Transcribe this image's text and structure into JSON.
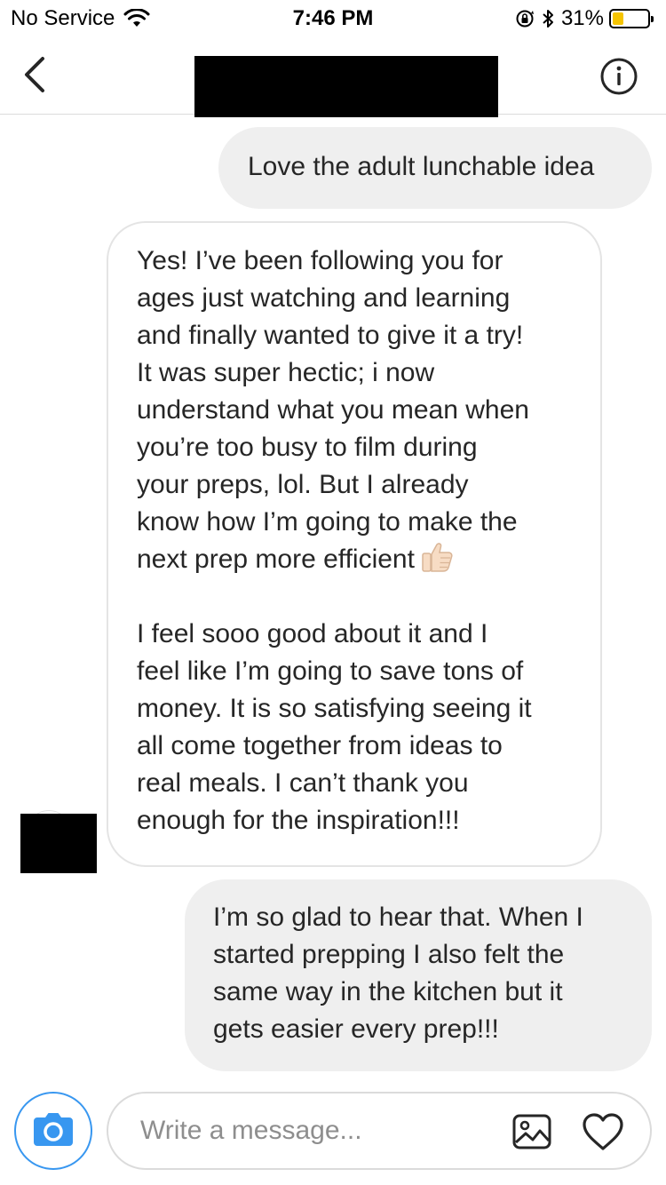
{
  "status_bar": {
    "carrier": "No Service",
    "time": "7:46 PM",
    "battery_percent": "31%",
    "battery_level": 0.31,
    "icons": [
      "wifi-icon",
      "orientation-lock-icon",
      "bluetooth-icon",
      "battery-icon"
    ]
  },
  "nav": {
    "back_icon": "chevron-left-icon",
    "info_icon": "info-icon"
  },
  "messages": [
    {
      "direction": "outgoing",
      "paragraphs": [
        "Love the adult lunchable idea"
      ]
    },
    {
      "direction": "incoming",
      "paragraphs": [
        "Yes! I’ve been following you for\nages just watching and learning\nand finally wanted to give it a try!\nIt was super hectic; i now\nunderstand what you mean when\nyou’re too busy to film during\nyour preps, lol. But I already\nknow how I’m going to make the\nnext prep more efficient",
        "I feel sooo good about it and I\nfeel like I’m going to save tons of\nmoney. It is so satisfying seeing it\nall come together from ideas to\nreal meals. I can’t thank you\nenough for the inspiration!!!"
      ],
      "emoji": "thumbs-up-icon"
    },
    {
      "direction": "outgoing",
      "paragraphs": [
        "I’m so glad to hear that. When I\nstarted prepping I also felt the\nsame way in the kitchen but it\ngets easier every prep!!!"
      ]
    }
  ],
  "composer": {
    "placeholder": "Write a message...",
    "camera_icon": "camera-icon",
    "gallery_icon": "image-icon",
    "like_icon": "heart-icon"
  },
  "colors": {
    "accent": "#3897f0",
    "outgoing_bubble": "#efefef",
    "incoming_border": "#e4e4e4",
    "battery_fill": "#f5c400"
  }
}
